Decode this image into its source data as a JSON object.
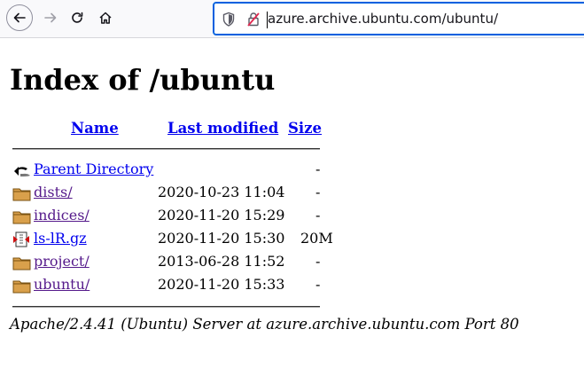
{
  "browser": {
    "url": "azure.archive.ubuntu.com/ubuntu/",
    "icons": [
      "back-arrow-icon",
      "forward-arrow-icon",
      "reload-icon",
      "home-icon",
      "shield-icon",
      "insecure-lock-icon"
    ]
  },
  "page": {
    "title": "Index of /ubuntu",
    "headers": {
      "name": "Name",
      "last_modified": "Last modified",
      "size": "Size"
    },
    "rows": [
      {
        "name": "Parent Directory",
        "date": "",
        "size": "-",
        "icon": "back-icon"
      },
      {
        "name": "dists/",
        "date": "2020-10-23 11:04",
        "size": "-",
        "icon": "folder-icon"
      },
      {
        "name": "indices/",
        "date": "2020-11-20 15:29",
        "size": "-",
        "icon": "folder-icon"
      },
      {
        "name": "ls-lR.gz",
        "date": "2020-11-20 15:30",
        "size": "20M",
        "icon": "compressed-file-icon"
      },
      {
        "name": "project/",
        "date": "2013-06-28 11:52",
        "size": "-",
        "icon": "folder-icon"
      },
      {
        "name": "ubuntu/",
        "date": "2020-11-20 15:33",
        "size": "-",
        "icon": "folder-icon"
      }
    ],
    "footer": "Apache/2.4.41 (Ubuntu) Server at azure.archive.ubuntu.com Port 80"
  }
}
